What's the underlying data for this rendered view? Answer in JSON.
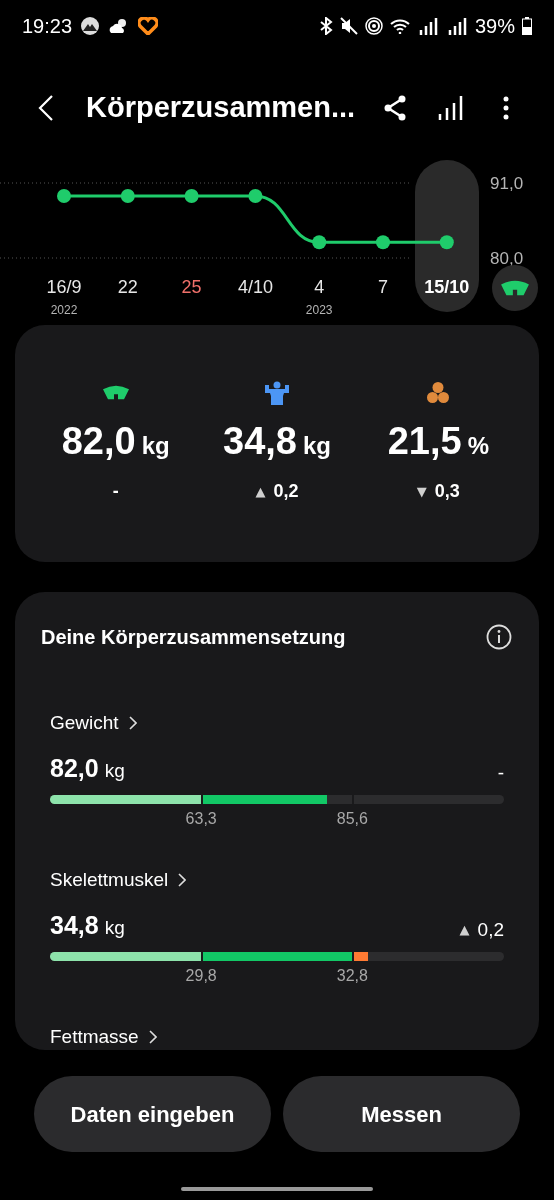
{
  "status_bar": {
    "time": "19:23",
    "battery": "39%"
  },
  "header": {
    "title": "Körperzusammen..."
  },
  "chart": {
    "category_details": [
      {
        "year": "2022",
        "selected": false,
        "color": "#e6e6e6"
      },
      {
        "selected": false,
        "color": "#e6e6e6"
      },
      {
        "selected": false,
        "color": "#f0706a"
      },
      {
        "selected": false,
        "color": "#e6e6e6"
      },
      {
        "year": "2023",
        "selected": false,
        "color": "#e6e6e6"
      },
      {
        "selected": false,
        "color": "#e6e6e6"
      },
      {
        "selected": true,
        "color": "#ffffff"
      }
    ],
    "chart_data": {
      "type": "line",
      "categories": [
        "16/9",
        "22",
        "25",
        "4/10",
        "4",
        "7",
        "15/10"
      ],
      "yticks": [
        {
          "value": 80,
          "label": "80,0"
        },
        {
          "value": 91,
          "label": "91,0"
        }
      ],
      "ylim": [
        80,
        91
      ],
      "series": [
        {
          "color": "#1fcc6b",
          "marker": "circle",
          "values": [
            89.1,
            89.1,
            89.1,
            89.1,
            82.3,
            82.3,
            82.3
          ]
        }
      ]
    }
  },
  "summary": [
    {
      "kind": "weight",
      "value": "82,0",
      "unit": "kg",
      "change": "-"
    },
    {
      "kind": "muscle",
      "value": "34,8",
      "unit": "kg",
      "arrow": "▲",
      "change": "0,2"
    },
    {
      "kind": "fat",
      "value": "21,5",
      "unit": "%",
      "arrow": "▼",
      "change": "0,3"
    }
  ],
  "composition": {
    "title": "Deine Körperzusammensetzung",
    "items": [
      {
        "name": "Gewicht",
        "value": "82,0",
        "unit": "kg",
        "change": "-",
        "range_labels": [
          "63,3",
          "85,6"
        ]
      },
      {
        "name": "Skelettmuskel",
        "value": "34,8",
        "unit": "kg",
        "arrow": "▲",
        "change": "0,2",
        "range_labels": [
          "29,8",
          "32,8"
        ]
      },
      {
        "name": "Fettmasse"
      }
    ]
  },
  "buttons": [
    "Daten eingeben",
    "Messen"
  ]
}
